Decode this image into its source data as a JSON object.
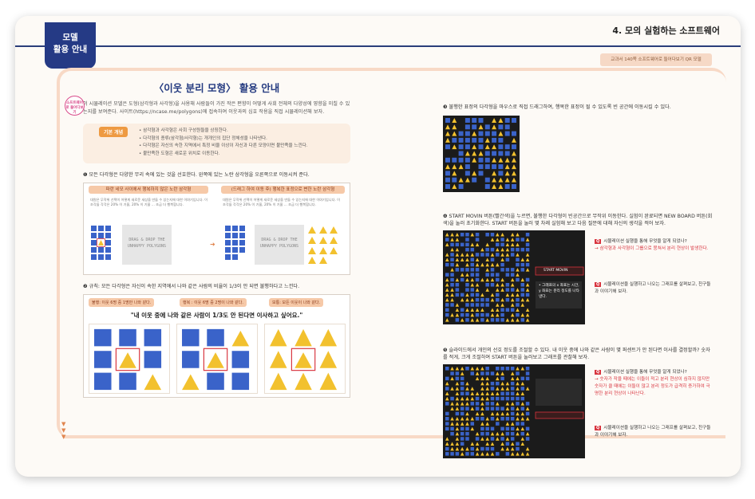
{
  "header": {
    "chapter_title": "4. 모의 실험하는 소프트웨어",
    "badge_line1": "모델",
    "badge_line2": "활용 안내",
    "qr_note": "교과서 140쪽 소프트웨어로 들어다보기 QR 모델"
  },
  "left": {
    "title": "〈이웃 분리 모형〉 활용 안내",
    "intro_badge": "소프트웨어로 들어다보기",
    "intro": "이 시뮬레이션 모델은 도형(삼각형과 사각형)을 사용해 사람들이 가진 작은 편향이 어떻게 사회 전체의 다양성에 영향을 미칠 수 있는지를 보여준다. 사이트(https://ncase.me/polygons)에 접속하여 이웃과의 심호 작용을 직접 시뮬레이션해 보자.",
    "concept_tag": "기본 개념",
    "concepts": [
      "삼각형과 사각형은 사회 구성원들을 상징한다.",
      "다각형의 종류(삼각형/사각형)는 개개인의 집단 정체성을 나타낸다.",
      "다각형은 자신의 속한 지역에서 특정 비율 이상이 자신과 다른 모양이면 불만족을 느낀다.",
      "불만족한 도형은 새로운 위치로 이동한다."
    ],
    "step1": "❶ 모든 다각형은 다양한 무리 속에 있는 것을 선호한다. 왼쪽에 있는 노란 삼각형을 오른쪽으로 이동시켜 준다.",
    "fig1_head_left": "파란 네모 사이에서 행복하지 않은 노란 삼각형",
    "fig1_head_right": "(드래그 하여 이동 후) 행복한 표정으로 변한 노란 삼각형",
    "fig1_text": "대원은 무작위 선택이 어떻게 새로운 세상을 만들 수 있는지에 대한 이야기입니다. 이 조각들 각각은 20% 이 기울, 20% 이 기울 ... 조금 더 행복합니다.",
    "drag_label": "DRAG & DROP THE UNHAPPY POLYGONS",
    "step2": "❷ 규칙: 모든 다각형은 자신이 속한 지역에서 나와 같은 사람의 비율이 1/3이 안 되면 불행하다고 느낀다.",
    "fig2_tag1": "불행: 이웃 6명 중 1명만 나와 같다.",
    "fig2_tag2": "행복 : 이웃 6명 중 2명이 나와 같다.",
    "fig2_tag3": "보통: 모든 이웃이 나와 같다.",
    "fig2_quote": "\"내 이웃 중에 나와 같은 사람이 1/3도 안 된다면 이사하고 싶어요.\""
  },
  "right": {
    "step3": "❸ 불행한 표정의 다각형을 마우스로 직접 드래그하여, 행복한 표정이 될 수 있도록 빈 공간에 이동시킬 수 있다.",
    "step4": "❹ START MOVIN 버튼(빨간색)을 누르면, 불행한 다각형이 빈공간으로 무작위 이동한다. 실험이 완료되면 NEW BOARD 버튼(회색)을 눌러 초기화한다. START 버튼을 눌러 몇 차례 실험해 보고 다음 질문에 대해 자신의 생각을 적어 보자.",
    "q1": "시뮬레이션 실행을 통해 무엇을 알게 되었나?",
    "q1_answer": "→ 삼각형과 사각형이 그룹으로 뭉쳐서 분리 현상이 발생한다.",
    "q2": "시뮬레이션을 실행하고 나오는 그래프를 살펴보고, 친구들과 이야기해 보자.",
    "sim1_callout": "• 그래프의 x 좌표는 시간, y 좌표는 분리 정도를 나타낸다.",
    "sim1_button": "START MOVIN",
    "step5": "❺ 슬라이드에서 개인의 선호 정도를 조절할 수 있다. 내 이웃 중에 나와 같은 사람이 몇 퍼센트가 안 된다면 이사를 결정할까? 숫자를 적게, 크게 조절하여 START 버튼을 눌러보고 그래프를 관찰해 보자.",
    "q3": "시뮬레이션 실행을 통해 무엇을 알게 되었나?",
    "q3_answer": "→ 숫자가 작을 때에는 이들이 적고 분리 현상이 심하지 않지만 숫자가 클 때에는 이들이 많고 분리 정도가 급격히 증가하여 극명한 분리 현상이 나타난다.",
    "q4": "시뮬레이션을 실행하고 나오는 그래프를 살펴보고, 친구들과 이야기해 보자."
  },
  "colors": {
    "navy": "#253a85",
    "accent": "#ee9a42",
    "frame": "#f8d9c6",
    "blue_shape": "#3a63c9",
    "yellow_shape": "#f2c12e",
    "red": "#d8343e"
  }
}
